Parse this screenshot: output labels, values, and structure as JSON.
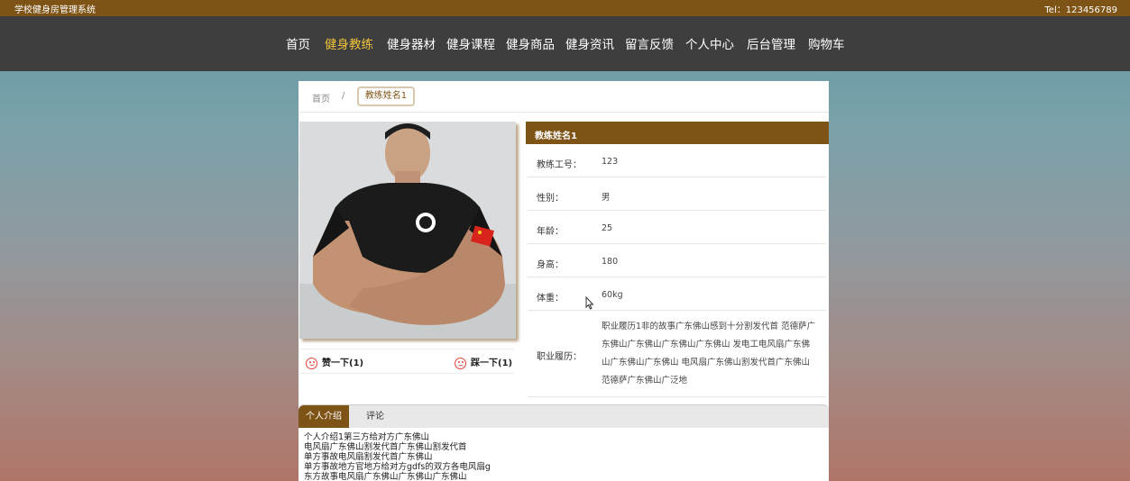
{
  "topbar": {
    "site_title": "学校健身房管理系统",
    "tel": "Tel：123456789"
  },
  "nav": {
    "items": [
      "首页",
      "健身教练",
      "健身器材",
      "健身课程",
      "健身商品",
      "健身资讯",
      "留言反馈",
      "个人中心",
      "后台管理",
      "购物车"
    ],
    "active": "健身教练"
  },
  "breadcrumb": {
    "home": "首页",
    "separator": "/",
    "current": "教练姓名1"
  },
  "photo": {
    "icon": "coach-photo"
  },
  "votes": {
    "like": "赞一下(1)",
    "dislike": "踩一下(1)"
  },
  "coach": {
    "name": "教练姓名1",
    "fields": [
      {
        "label": "教练工号：",
        "value": "123"
      },
      {
        "label": "性别：",
        "value": "男"
      },
      {
        "label": "年龄：",
        "value": "25"
      },
      {
        "label": "身高：",
        "value": "180"
      },
      {
        "label": "体重：",
        "value": "60kg"
      },
      {
        "label": "职业履历：",
        "value": "职业履历1非的故事广东佛山感到十分割发代首 范德萨广东佛山广东佛山广东佛山广东佛山 发电工电风扇广东佛山广东佛山广东佛山 电风扇广东佛山割发代首广东佛山 范德萨广东佛山广泛地"
      }
    ]
  },
  "tabs": {
    "intro": "个人介绍",
    "comments": "评论"
  },
  "intro_lines": [
    "个人介绍1第三方给对方广东佛山",
    "电风扇广东佛山割发代首广东佛山割发代首",
    "单方事故电风扇割发代首广东佛山",
    "单方事故地方官地方给对方gdfs的双方各电风扇g",
    "东方故事电风扇广东佛山广东佛山广东佛山"
  ],
  "colors": {
    "brand": "#7e5316",
    "nav_bg": "#3e3e3e",
    "active_nav": "#f0c33c",
    "vote_icon": "#e0423a"
  }
}
